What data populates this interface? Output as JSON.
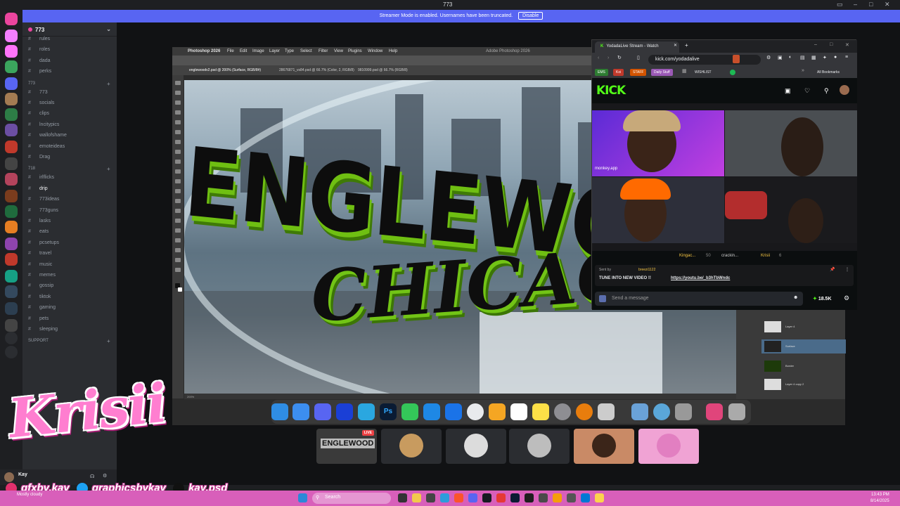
{
  "window": {
    "title": "773"
  },
  "banner": {
    "text": "Streamer Mode is enabled. Usernames have been truncated.",
    "button": "Disable"
  },
  "server": {
    "name": "773",
    "channels_top": [
      "rules",
      "roles",
      "dada",
      "perks"
    ],
    "category_773": "773",
    "channels_773": [
      "773",
      "socials",
      "clips",
      "lncitypics",
      "wallofshame",
      "emoteideas",
      "Drag"
    ],
    "category_718": "718",
    "channels_718": [
      "irlflicks",
      "drip",
      "773ideas",
      "773guns",
      "lasks",
      "eats",
      "pcsetups",
      "travel",
      "music",
      "memes",
      "gossip",
      "tiktok",
      "gaming",
      "pets",
      "sleeping"
    ],
    "category_support": "SUPPORT"
  },
  "user": {
    "name": "Kay",
    "status": "Mostly cloudy"
  },
  "logo": {
    "text": "Krisii"
  },
  "socials": [
    "gfxby.kay",
    "graphicsbykay",
    "kay.psd"
  ],
  "photoshop": {
    "app_title": "Photoshop 2026",
    "menus": [
      "File",
      "Edit",
      "Image",
      "Layer",
      "Type",
      "Select",
      "Filter",
      "View",
      "Plugins",
      "Window",
      "Help"
    ],
    "header_right": "Adobe Photoshop 2026",
    "tabs": [
      "englewoodv2.psd @ 200% (Surface, RGB/8#)",
      "28676871_vs84.psd @ 66.7% (Color, 2, RGB/8)",
      "9810999.psd @ 66.7% (RGB/8)"
    ],
    "status": "200%",
    "canvas_text_1": "ENGLEWO",
    "canvas_text_2": "CHICAGO",
    "layers": [
      "Layer 4",
      "Surface",
      "Border",
      "Layer 4 copy 2"
    ]
  },
  "browser": {
    "tab_title": "YodadaLive Stream - Watch",
    "url": "kick.com/yodadalive",
    "bookmarks": [
      "EMS",
      "Koi",
      "STAFF",
      "Daily Stuff",
      "WISHLIST"
    ],
    "all_bookmarks": "All Bookmarks",
    "site_logo": "KICK",
    "gifters": [
      "Kingac...",
      "crackin...",
      "Krisii"
    ],
    "gift_counts": [
      "50",
      "",
      "6"
    ],
    "sent_by": "Sent by",
    "sent_user": "breezi1122",
    "pinned_message": "TUNE INTO NEW VIDEO !!",
    "pinned_link": "https://youtu.be/_b3hTbWndc",
    "chat_placeholder": "Send a message",
    "viewers": "18.5K",
    "overlay_text": "monkey.app"
  },
  "tiles": {
    "live_label": "LIVE",
    "tile1_text": "ENGLEWOOD"
  },
  "taskbar": {
    "search": "Search",
    "time": "13:43 PM",
    "date": "8/14/2025"
  },
  "colors": {
    "accent": "#5865f2",
    "kick_green": "#53fc18",
    "taskbar": "#d85fba",
    "logo_pink": "#ff7ed0"
  }
}
